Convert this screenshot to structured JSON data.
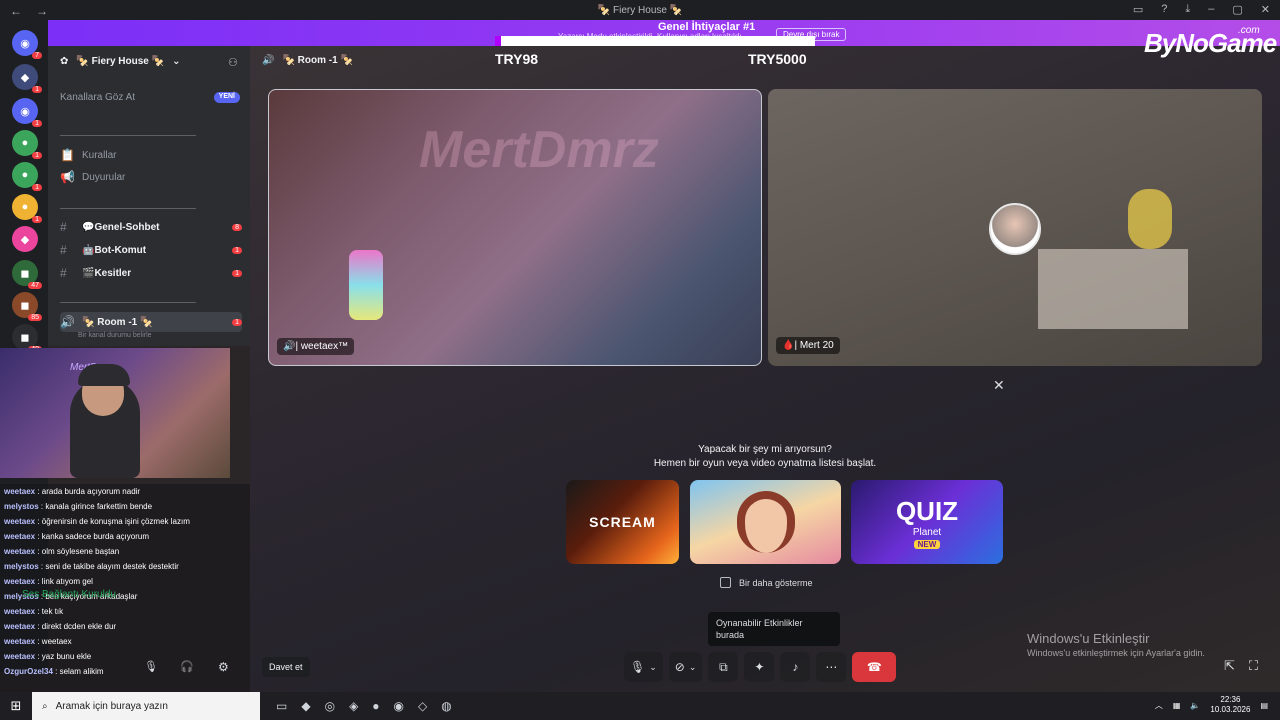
{
  "titlebar": {
    "title": "🍢 Fiery House 🍢",
    "back": "←",
    "forward": "→"
  },
  "banner": {
    "title": "Genel İhtiyaçlar #1",
    "subtitle": "Yazarcı Modu etkinleştirildi. Kullanıcı adları kısaltıldı",
    "button": "Devre dışı bırak",
    "progress_fraction": 0.02,
    "left_label": "TRY98",
    "right_label": "TRY5000",
    "brand": "ByNoGame",
    "brand_suffix": ".com"
  },
  "rail": [
    {
      "icon": "discord-icon",
      "glyph": "◉",
      "badge": "7",
      "color": "#5865f2"
    },
    {
      "icon": "server-icon",
      "glyph": "◆",
      "badge": "1",
      "color": "#3f4b7a"
    },
    {
      "icon": "server-icon",
      "glyph": "◉",
      "badge": "1",
      "color": "#5865f2"
    },
    {
      "icon": "server-icon",
      "glyph": "●",
      "badge": "1",
      "color": "#3ba55c"
    },
    {
      "icon": "server-icon",
      "glyph": "●",
      "badge": "1",
      "color": "#3ba55c"
    },
    {
      "icon": "server-icon",
      "glyph": "●",
      "badge": "1",
      "color": "#f0b232"
    },
    {
      "icon": "server-icon",
      "glyph": "◆",
      "badge": "",
      "color": "#eb459e"
    },
    {
      "icon": "server-icon",
      "glyph": "◼",
      "badge": "47",
      "color": "#2f6b3a"
    },
    {
      "icon": "server-icon",
      "glyph": "◼",
      "badge": "85",
      "color": "#8a4a2a"
    },
    {
      "icon": "server-icon",
      "glyph": "◼",
      "badge": "40",
      "color": "#2b2d31"
    }
  ],
  "sidebar": {
    "server_name": "🍢 Fiery House 🍢",
    "browse_label": "Kanallara Göz At",
    "new_badge": "YENİ",
    "channels": [
      {
        "symbol": "📋",
        "name": "Kurallar",
        "count": ""
      },
      {
        "symbol": "📢",
        "name": "Duyurular",
        "count": ""
      },
      {
        "symbol": "#",
        "name": "💬Genel-Sohbet",
        "count": "8",
        "unread": true
      },
      {
        "symbol": "#",
        "name": "🤖Bot-Komut",
        "count": "1",
        "unread": true
      },
      {
        "symbol": "#",
        "name": "🎬Kesitler",
        "count": "1",
        "unread": true
      },
      {
        "symbol": "🔊",
        "name": "🍢 Room -1 🍢",
        "count": "1",
        "unread": true
      }
    ],
    "status_placeholder": "Bir kanal durumu belirle"
  },
  "webcam": {
    "watermark": "MertDmrz"
  },
  "chat": [
    {
      "user": "weetaex",
      "text": "arada burda açıyorum nadir"
    },
    {
      "user": "melystos",
      "text": "kanala girince farkettim bende"
    },
    {
      "user": "weetaex",
      "text": "öğrenirsin de konuşma işini çözmek lazım"
    },
    {
      "user": "weetaex",
      "text": "kanka sadece burda açıyorum"
    },
    {
      "user": "weetaex",
      "text": "olm söylesene baştan"
    },
    {
      "user": "melystos",
      "text": "seni de takibe alayım destek destektir"
    },
    {
      "user": "weetaex",
      "text": "link atıyom gel"
    },
    {
      "user": "melystos",
      "text": "ben kaçıyorum arkadaşlar"
    },
    {
      "user": "weetaex",
      "text": "tek tık"
    },
    {
      "user": "weetaex",
      "text": "direkt dcden ekle dur"
    },
    {
      "user": "weetaex",
      "text": "weetaex"
    },
    {
      "user": "weetaex",
      "text": "yaz bunu ekle"
    },
    {
      "user": "OzgurOzel34",
      "text": "selam alikim"
    }
  ],
  "side_status": "Ses Bağlantı Kuruldu",
  "stage": {
    "room_title": "🍢 Room -1 🍢",
    "tile1_name": "🔊| weetaex™",
    "tile1_watermark": "MertDmrz",
    "tile2_name": "🩸| Mert 20",
    "activity_line1": "Yapacak bir şey mi arıyorsun?",
    "activity_line2": "Hemen bir oyun veya video oynatma listesi başlat.",
    "cards": [
      {
        "title": "SCREAM"
      },
      {
        "title": ""
      },
      {
        "title": "QUIZ",
        "sub": "Planet",
        "tag": "NEW"
      }
    ],
    "dont_show": "Bir daha gösterme",
    "tooltip_line1": "Oynanabilir Etkinlikler",
    "tooltip_line2": "burada",
    "invite": "Davet et"
  },
  "windows_activate": {
    "line1": "Windows'u Etkinleştir",
    "line2": "Windows'u etkinleştirmek için Ayarlar'a gidin."
  },
  "taskbar": {
    "search_placeholder": "Aramak için buraya yazın",
    "time": "22:36",
    "date": "10.03.2026"
  },
  "colors": {
    "accent": "#5865f2",
    "danger": "#da373c",
    "banner": "#9b3cf0"
  }
}
